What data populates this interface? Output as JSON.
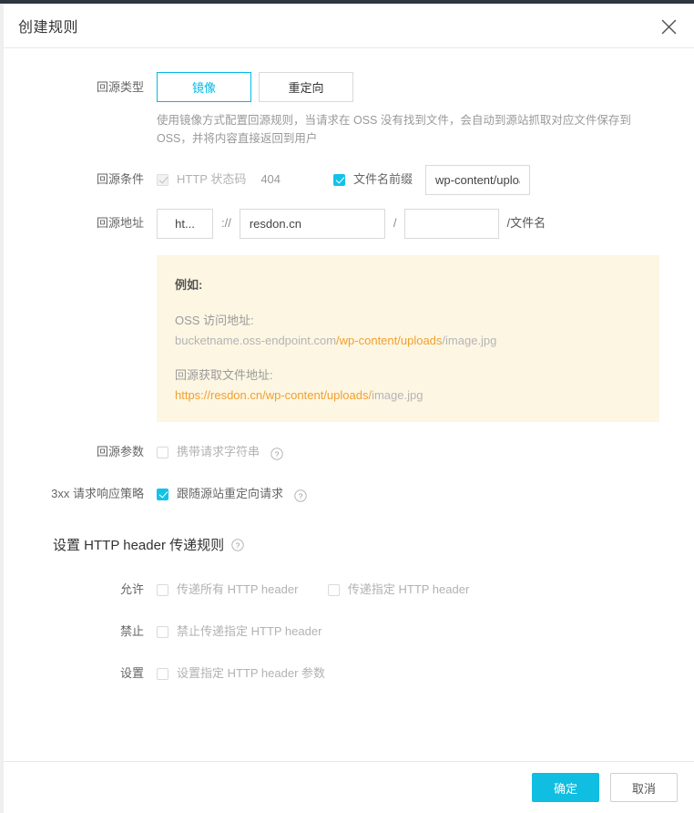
{
  "modal": {
    "title": "创建规则",
    "close_icon": "close-icon"
  },
  "rows": {
    "origin_type": {
      "label": "回源类型",
      "options": [
        "镜像",
        "重定向"
      ],
      "selected": "镜像",
      "description": "使用镜像方式配置回源规则，当请求在 OSS 没有找到文件，会自动到源站抓取对应文件保存到 OSS，并将内容直接返回到用户"
    },
    "origin_condition": {
      "label": "回源条件",
      "http_status": {
        "label": "HTTP 状态码",
        "value": "404",
        "checked": true,
        "disabled": true
      },
      "file_prefix": {
        "label": "文件名前缀",
        "checked": true,
        "input_value": "wp-content/uploads/",
        "placeholder": ""
      }
    },
    "origin_address": {
      "label": "回源地址",
      "protocol": "ht...",
      "protocol_separator": "://",
      "host": "resdon.cn",
      "path_separator": "/",
      "path": "",
      "path_placeholder": "",
      "suffix": "/文件名"
    },
    "example": {
      "title": "例如:",
      "oss_label": "OSS 访问地址:",
      "oss_url_prefix": "bucketname.oss-endpoint.com",
      "oss_url_highlight": "/wp-content/uploads",
      "oss_url_suffix": "/image.jpg",
      "origin_label": "回源获取文件地址:",
      "origin_url_highlight": "https://resdon.cn/wp-content/uploads/",
      "origin_url_suffix": "image.jpg"
    },
    "origin_params": {
      "label": "回源参数",
      "carry_query_string": {
        "label": "携带请求字符串",
        "checked": false,
        "help_icon": "help-circle-icon"
      }
    },
    "redirect_policy": {
      "label": "3xx 请求响应策略",
      "follow_redirect": {
        "label": "跟随源站重定向请求",
        "checked": true,
        "help_icon": "help-circle-icon"
      }
    },
    "header_rules": {
      "section_title": "设置 HTTP header 传递规则",
      "section_help_icon": "help-circle-icon",
      "allow": {
        "label": "允许",
        "items": [
          {
            "label": "传递所有 HTTP header",
            "checked": false
          },
          {
            "label": "传递指定 HTTP header",
            "checked": false
          }
        ]
      },
      "forbid": {
        "label": "禁止",
        "items": [
          {
            "label": "禁止传递指定 HTTP header",
            "checked": false
          }
        ]
      },
      "set": {
        "label": "设置",
        "items": [
          {
            "label": "设置指定 HTTP header 参数",
            "checked": false
          }
        ]
      }
    }
  },
  "footer": {
    "confirm_label": "确定",
    "cancel_label": "取消"
  },
  "colors": {
    "accent": "#00b9e6",
    "primary_button": "#0fbee0",
    "checkbox_checked": "#13c2e8",
    "example_background": "#fdf6e3",
    "highlight_orange": "#f0a030"
  }
}
